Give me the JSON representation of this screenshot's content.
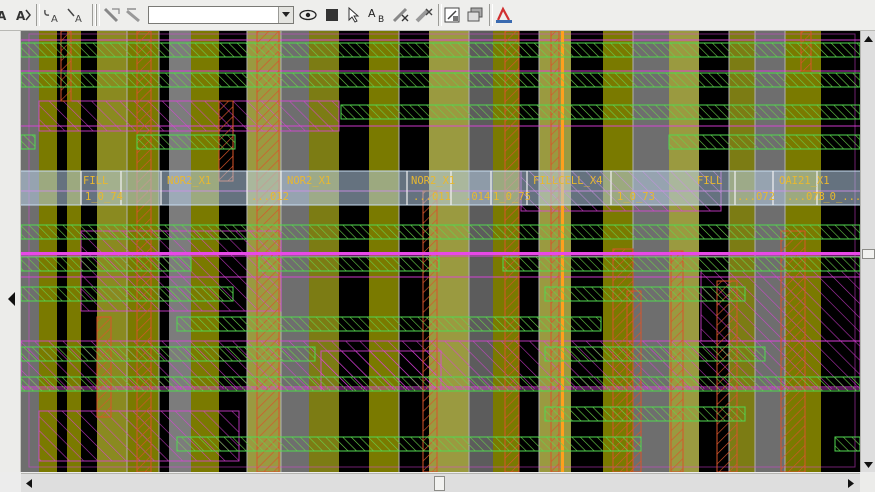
{
  "toolbar": {
    "combo_value": "",
    "icons": [
      "find-all-icon",
      "find-next-icon",
      "text-a-icon",
      "text-a2-icon",
      "ruler-icon",
      "measure-icon",
      "eye-icon",
      "stop-icon",
      "pointer-icon",
      "text-ab-icon",
      "delete-ruler-icon",
      "clear-icon",
      "grid-icon",
      "layers-icon",
      "highlight-icon"
    ]
  },
  "layout": {
    "cell_labels": [
      "FILL",
      "NOR2_X1",
      "NOR2_X1",
      "NOR2_X1",
      "FILLCELL_X4",
      "FILL",
      "OAI21_X1"
    ],
    "instance_labels": [
      "1_0_74",
      "...012",
      "...011",
      ".014",
      "1_0_75",
      "1_0_73",
      "...072",
      "...073",
      "1_0_..."
    ],
    "colors": {
      "metal_fill": "#7a7a00",
      "poly_hatch": "#d8542a",
      "metal2_hatch": "#e040e0",
      "via_hatch": "#50d850",
      "rail": "#b8d0e8",
      "label_text": "#e8b830",
      "active_line": "#ff8c00"
    }
  }
}
